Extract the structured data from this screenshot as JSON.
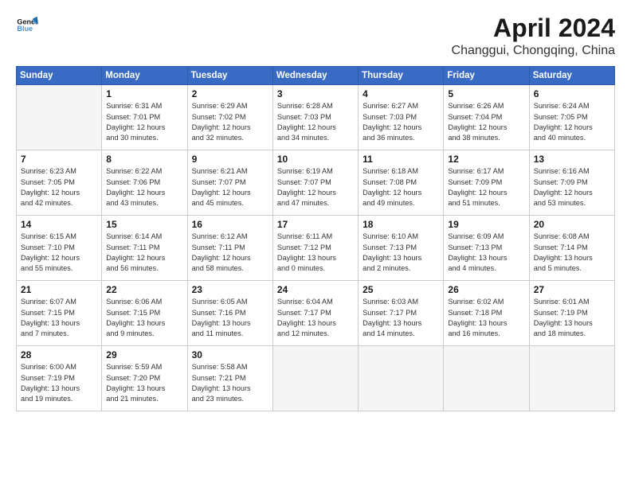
{
  "logo": {
    "line1": "General",
    "line2": "Blue"
  },
  "title": "April 2024",
  "location": "Changgui, Chongqing, China",
  "headers": [
    "Sunday",
    "Monday",
    "Tuesday",
    "Wednesday",
    "Thursday",
    "Friday",
    "Saturday"
  ],
  "weeks": [
    [
      {
        "day": "",
        "info": ""
      },
      {
        "day": "1",
        "info": "Sunrise: 6:31 AM\nSunset: 7:01 PM\nDaylight: 12 hours\nand 30 minutes."
      },
      {
        "day": "2",
        "info": "Sunrise: 6:29 AM\nSunset: 7:02 PM\nDaylight: 12 hours\nand 32 minutes."
      },
      {
        "day": "3",
        "info": "Sunrise: 6:28 AM\nSunset: 7:03 PM\nDaylight: 12 hours\nand 34 minutes."
      },
      {
        "day": "4",
        "info": "Sunrise: 6:27 AM\nSunset: 7:03 PM\nDaylight: 12 hours\nand 36 minutes."
      },
      {
        "day": "5",
        "info": "Sunrise: 6:26 AM\nSunset: 7:04 PM\nDaylight: 12 hours\nand 38 minutes."
      },
      {
        "day": "6",
        "info": "Sunrise: 6:24 AM\nSunset: 7:05 PM\nDaylight: 12 hours\nand 40 minutes."
      }
    ],
    [
      {
        "day": "7",
        "info": "Sunrise: 6:23 AM\nSunset: 7:05 PM\nDaylight: 12 hours\nand 42 minutes."
      },
      {
        "day": "8",
        "info": "Sunrise: 6:22 AM\nSunset: 7:06 PM\nDaylight: 12 hours\nand 43 minutes."
      },
      {
        "day": "9",
        "info": "Sunrise: 6:21 AM\nSunset: 7:07 PM\nDaylight: 12 hours\nand 45 minutes."
      },
      {
        "day": "10",
        "info": "Sunrise: 6:19 AM\nSunset: 7:07 PM\nDaylight: 12 hours\nand 47 minutes."
      },
      {
        "day": "11",
        "info": "Sunrise: 6:18 AM\nSunset: 7:08 PM\nDaylight: 12 hours\nand 49 minutes."
      },
      {
        "day": "12",
        "info": "Sunrise: 6:17 AM\nSunset: 7:09 PM\nDaylight: 12 hours\nand 51 minutes."
      },
      {
        "day": "13",
        "info": "Sunrise: 6:16 AM\nSunset: 7:09 PM\nDaylight: 12 hours\nand 53 minutes."
      }
    ],
    [
      {
        "day": "14",
        "info": "Sunrise: 6:15 AM\nSunset: 7:10 PM\nDaylight: 12 hours\nand 55 minutes."
      },
      {
        "day": "15",
        "info": "Sunrise: 6:14 AM\nSunset: 7:11 PM\nDaylight: 12 hours\nand 56 minutes."
      },
      {
        "day": "16",
        "info": "Sunrise: 6:12 AM\nSunset: 7:11 PM\nDaylight: 12 hours\nand 58 minutes."
      },
      {
        "day": "17",
        "info": "Sunrise: 6:11 AM\nSunset: 7:12 PM\nDaylight: 13 hours\nand 0 minutes."
      },
      {
        "day": "18",
        "info": "Sunrise: 6:10 AM\nSunset: 7:13 PM\nDaylight: 13 hours\nand 2 minutes."
      },
      {
        "day": "19",
        "info": "Sunrise: 6:09 AM\nSunset: 7:13 PM\nDaylight: 13 hours\nand 4 minutes."
      },
      {
        "day": "20",
        "info": "Sunrise: 6:08 AM\nSunset: 7:14 PM\nDaylight: 13 hours\nand 5 minutes."
      }
    ],
    [
      {
        "day": "21",
        "info": "Sunrise: 6:07 AM\nSunset: 7:15 PM\nDaylight: 13 hours\nand 7 minutes."
      },
      {
        "day": "22",
        "info": "Sunrise: 6:06 AM\nSunset: 7:15 PM\nDaylight: 13 hours\nand 9 minutes."
      },
      {
        "day": "23",
        "info": "Sunrise: 6:05 AM\nSunset: 7:16 PM\nDaylight: 13 hours\nand 11 minutes."
      },
      {
        "day": "24",
        "info": "Sunrise: 6:04 AM\nSunset: 7:17 PM\nDaylight: 13 hours\nand 12 minutes."
      },
      {
        "day": "25",
        "info": "Sunrise: 6:03 AM\nSunset: 7:17 PM\nDaylight: 13 hours\nand 14 minutes."
      },
      {
        "day": "26",
        "info": "Sunrise: 6:02 AM\nSunset: 7:18 PM\nDaylight: 13 hours\nand 16 minutes."
      },
      {
        "day": "27",
        "info": "Sunrise: 6:01 AM\nSunset: 7:19 PM\nDaylight: 13 hours\nand 18 minutes."
      }
    ],
    [
      {
        "day": "28",
        "info": "Sunrise: 6:00 AM\nSunset: 7:19 PM\nDaylight: 13 hours\nand 19 minutes."
      },
      {
        "day": "29",
        "info": "Sunrise: 5:59 AM\nSunset: 7:20 PM\nDaylight: 13 hours\nand 21 minutes."
      },
      {
        "day": "30",
        "info": "Sunrise: 5:58 AM\nSunset: 7:21 PM\nDaylight: 13 hours\nand 23 minutes."
      },
      {
        "day": "",
        "info": ""
      },
      {
        "day": "",
        "info": ""
      },
      {
        "day": "",
        "info": ""
      },
      {
        "day": "",
        "info": ""
      }
    ]
  ]
}
